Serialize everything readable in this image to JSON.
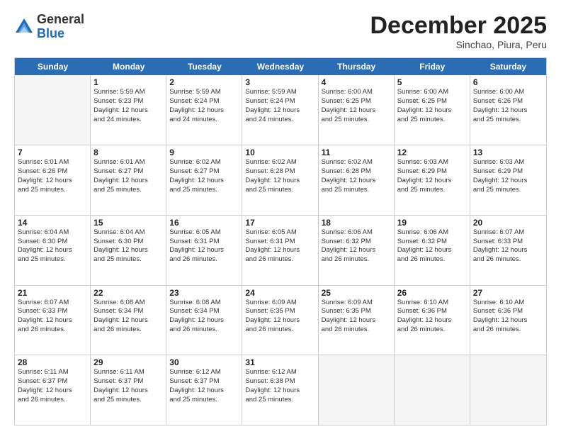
{
  "logo": {
    "general": "General",
    "blue": "Blue"
  },
  "title": "December 2025",
  "location": "Sinchao, Piura, Peru",
  "weekdays": [
    "Sunday",
    "Monday",
    "Tuesday",
    "Wednesday",
    "Thursday",
    "Friday",
    "Saturday"
  ],
  "weeks": [
    [
      {
        "day": "",
        "info": ""
      },
      {
        "day": "1",
        "info": "Sunrise: 5:59 AM\nSunset: 6:23 PM\nDaylight: 12 hours\nand 24 minutes."
      },
      {
        "day": "2",
        "info": "Sunrise: 5:59 AM\nSunset: 6:24 PM\nDaylight: 12 hours\nand 24 minutes."
      },
      {
        "day": "3",
        "info": "Sunrise: 5:59 AM\nSunset: 6:24 PM\nDaylight: 12 hours\nand 24 minutes."
      },
      {
        "day": "4",
        "info": "Sunrise: 6:00 AM\nSunset: 6:25 PM\nDaylight: 12 hours\nand 25 minutes."
      },
      {
        "day": "5",
        "info": "Sunrise: 6:00 AM\nSunset: 6:25 PM\nDaylight: 12 hours\nand 25 minutes."
      },
      {
        "day": "6",
        "info": "Sunrise: 6:00 AM\nSunset: 6:26 PM\nDaylight: 12 hours\nand 25 minutes."
      }
    ],
    [
      {
        "day": "7",
        "info": "Sunrise: 6:01 AM\nSunset: 6:26 PM\nDaylight: 12 hours\nand 25 minutes."
      },
      {
        "day": "8",
        "info": "Sunrise: 6:01 AM\nSunset: 6:27 PM\nDaylight: 12 hours\nand 25 minutes."
      },
      {
        "day": "9",
        "info": "Sunrise: 6:02 AM\nSunset: 6:27 PM\nDaylight: 12 hours\nand 25 minutes."
      },
      {
        "day": "10",
        "info": "Sunrise: 6:02 AM\nSunset: 6:28 PM\nDaylight: 12 hours\nand 25 minutes."
      },
      {
        "day": "11",
        "info": "Sunrise: 6:02 AM\nSunset: 6:28 PM\nDaylight: 12 hours\nand 25 minutes."
      },
      {
        "day": "12",
        "info": "Sunrise: 6:03 AM\nSunset: 6:29 PM\nDaylight: 12 hours\nand 25 minutes."
      },
      {
        "day": "13",
        "info": "Sunrise: 6:03 AM\nSunset: 6:29 PM\nDaylight: 12 hours\nand 25 minutes."
      }
    ],
    [
      {
        "day": "14",
        "info": "Sunrise: 6:04 AM\nSunset: 6:30 PM\nDaylight: 12 hours\nand 25 minutes."
      },
      {
        "day": "15",
        "info": "Sunrise: 6:04 AM\nSunset: 6:30 PM\nDaylight: 12 hours\nand 25 minutes."
      },
      {
        "day": "16",
        "info": "Sunrise: 6:05 AM\nSunset: 6:31 PM\nDaylight: 12 hours\nand 26 minutes."
      },
      {
        "day": "17",
        "info": "Sunrise: 6:05 AM\nSunset: 6:31 PM\nDaylight: 12 hours\nand 26 minutes."
      },
      {
        "day": "18",
        "info": "Sunrise: 6:06 AM\nSunset: 6:32 PM\nDaylight: 12 hours\nand 26 minutes."
      },
      {
        "day": "19",
        "info": "Sunrise: 6:06 AM\nSunset: 6:32 PM\nDaylight: 12 hours\nand 26 minutes."
      },
      {
        "day": "20",
        "info": "Sunrise: 6:07 AM\nSunset: 6:33 PM\nDaylight: 12 hours\nand 26 minutes."
      }
    ],
    [
      {
        "day": "21",
        "info": "Sunrise: 6:07 AM\nSunset: 6:33 PM\nDaylight: 12 hours\nand 26 minutes."
      },
      {
        "day": "22",
        "info": "Sunrise: 6:08 AM\nSunset: 6:34 PM\nDaylight: 12 hours\nand 26 minutes."
      },
      {
        "day": "23",
        "info": "Sunrise: 6:08 AM\nSunset: 6:34 PM\nDaylight: 12 hours\nand 26 minutes."
      },
      {
        "day": "24",
        "info": "Sunrise: 6:09 AM\nSunset: 6:35 PM\nDaylight: 12 hours\nand 26 minutes."
      },
      {
        "day": "25",
        "info": "Sunrise: 6:09 AM\nSunset: 6:35 PM\nDaylight: 12 hours\nand 26 minutes."
      },
      {
        "day": "26",
        "info": "Sunrise: 6:10 AM\nSunset: 6:36 PM\nDaylight: 12 hours\nand 26 minutes."
      },
      {
        "day": "27",
        "info": "Sunrise: 6:10 AM\nSunset: 6:36 PM\nDaylight: 12 hours\nand 26 minutes."
      }
    ],
    [
      {
        "day": "28",
        "info": "Sunrise: 6:11 AM\nSunset: 6:37 PM\nDaylight: 12 hours\nand 26 minutes."
      },
      {
        "day": "29",
        "info": "Sunrise: 6:11 AM\nSunset: 6:37 PM\nDaylight: 12 hours\nand 25 minutes."
      },
      {
        "day": "30",
        "info": "Sunrise: 6:12 AM\nSunset: 6:37 PM\nDaylight: 12 hours\nand 25 minutes."
      },
      {
        "day": "31",
        "info": "Sunrise: 6:12 AM\nSunset: 6:38 PM\nDaylight: 12 hours\nand 25 minutes."
      },
      {
        "day": "",
        "info": ""
      },
      {
        "day": "",
        "info": ""
      },
      {
        "day": "",
        "info": ""
      }
    ]
  ]
}
